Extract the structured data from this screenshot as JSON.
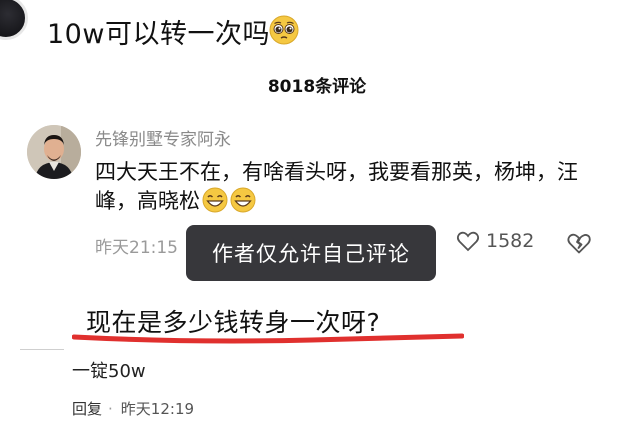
{
  "top_message": {
    "text": "10w可以转一次吗",
    "emoji": "pleading-face-icon"
  },
  "header": {
    "comment_count": "8018条评论"
  },
  "comment": {
    "username": "先锋别墅专家阿永",
    "text": "四大天王不在，有啥看头呀，我要看那英，杨坤，汪峰，高晓松",
    "time": "昨天21:15",
    "like_count": "1582"
  },
  "toast": {
    "text": "作者仅允许自己评论"
  },
  "highlighted_question": {
    "text": "现在是多少钱转身一次呀?",
    "underline_color": "#e0302e"
  },
  "reply": {
    "text": "一锭50w",
    "reply_label": "回复",
    "separator": "·",
    "time": "昨天12:19"
  },
  "colors": {
    "toast_bg": "#28282c",
    "muted_text": "#9a9a9a",
    "emoji_yellow": "#f5c842"
  }
}
